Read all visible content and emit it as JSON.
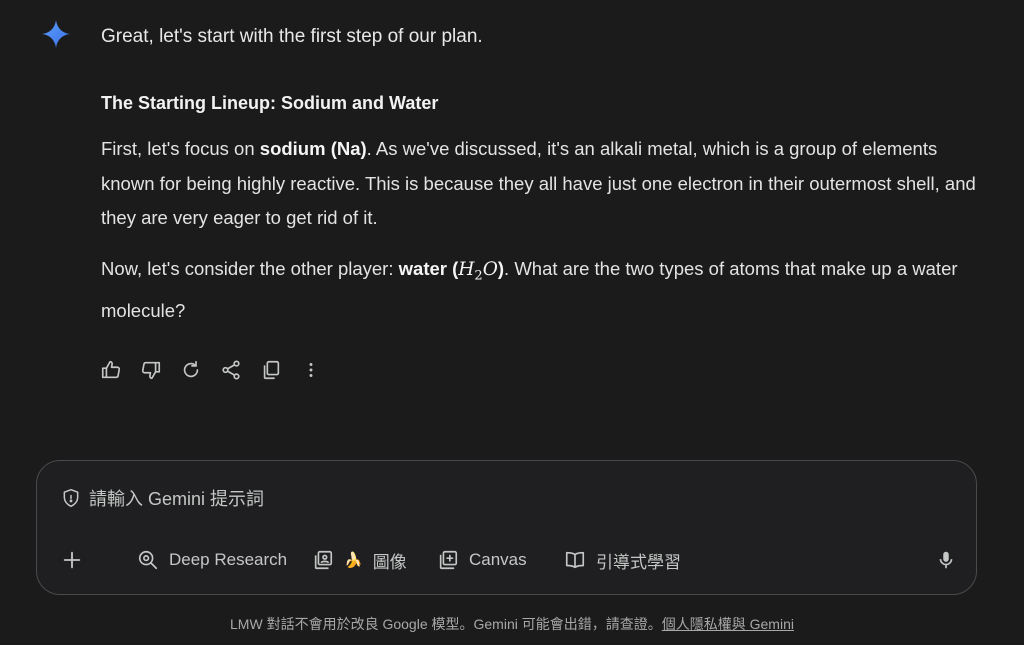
{
  "response": {
    "greeting": "Great, let's start with the first step of our plan.",
    "heading": "The Starting Lineup: Sodium and Water",
    "para1": {
      "pre": "First, let's focus on ",
      "bold": "sodium (Na)",
      "post": ". As we've discussed, it's an alkali metal, which is a group of elements known for being highly reactive. This is because they all have just one electron in their outermost shell, and they are very eager to get rid of it."
    },
    "para2": {
      "pre": "Now, let's consider the other player: ",
      "bold": "water (",
      "formula_h": "H",
      "formula_sub": "2",
      "formula_o": "O",
      "bold_close": ")",
      "post": ". What are the two types of atoms that make up a water molecule?"
    }
  },
  "actions": {
    "icons": [
      "thumbs-up-icon",
      "thumbs-down-icon",
      "redo-icon",
      "share-icon",
      "copy-icon",
      "more-vert-icon"
    ]
  },
  "composer": {
    "placeholder": "請輸入 Gemini 提示詞",
    "tools": {
      "deep_research": "Deep Research",
      "image": "圖像",
      "canvas": "Canvas",
      "guided_learning": "引導式學習"
    }
  },
  "footer": {
    "text": "LMW 對話不會用於改良 Google 模型。Gemini 可能會出錯，請查證。",
    "link": "個人隱私權與 Gemini"
  },
  "colors": {
    "background": "#1b1b1c",
    "accent_blue": "#4e8cf7",
    "text": "#e3e3e3"
  }
}
